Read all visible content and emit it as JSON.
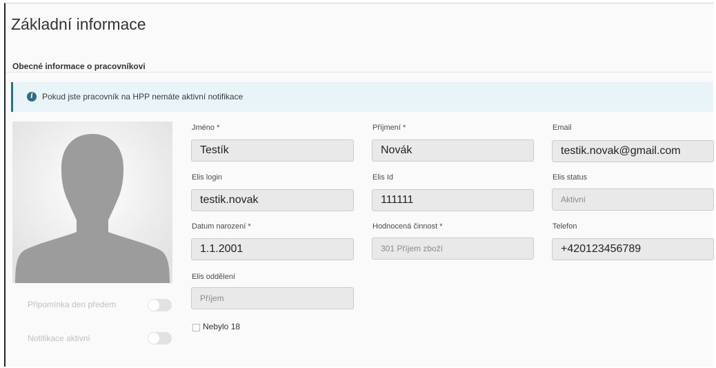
{
  "page": {
    "title": "Základní informace"
  },
  "section": {
    "title": "Obecné informace o pracovníkovi"
  },
  "alert": {
    "icon": "info-icon",
    "text": "Pokud jste pracovník na HPP nemáte aktivní notifikace"
  },
  "avatar": {
    "icon": "user-silhouette-icon"
  },
  "toggles": [
    {
      "label": "Připomínka den předem",
      "on": false
    },
    {
      "label": "Notifikace aktivní",
      "on": false
    }
  ],
  "fields": {
    "jmeno": {
      "label": "Jméno *",
      "value": "Testík"
    },
    "prijmeni": {
      "label": "Příjmení *",
      "value": "Novák"
    },
    "email": {
      "label": "Email",
      "value": "testik.novak@gmail.com"
    },
    "elis_login": {
      "label": "Elis login",
      "value": "testik.novak"
    },
    "elis_id": {
      "label": "Elis Id",
      "value": "111111"
    },
    "elis_status": {
      "label": "Elis status",
      "placeholder": "Aktivní"
    },
    "datum_narozeni": {
      "label": "Datum narození *",
      "value": "1.1.2001"
    },
    "hodnocena_cinnost": {
      "label": "Hodnocená činnost *",
      "placeholder": "301 Příjem zboží"
    },
    "telefon": {
      "label": "Telefon",
      "value": "+420123456789"
    },
    "elis_oddeleni": {
      "label": "Elis oddělení",
      "placeholder": "Příjem"
    }
  },
  "checkbox": {
    "label": "Nebylo 18",
    "checked": false
  },
  "colors": {
    "alert_bg": "#e8f4f8",
    "alert_border": "#2c6f86",
    "input_bg": "#e9e9e9"
  }
}
